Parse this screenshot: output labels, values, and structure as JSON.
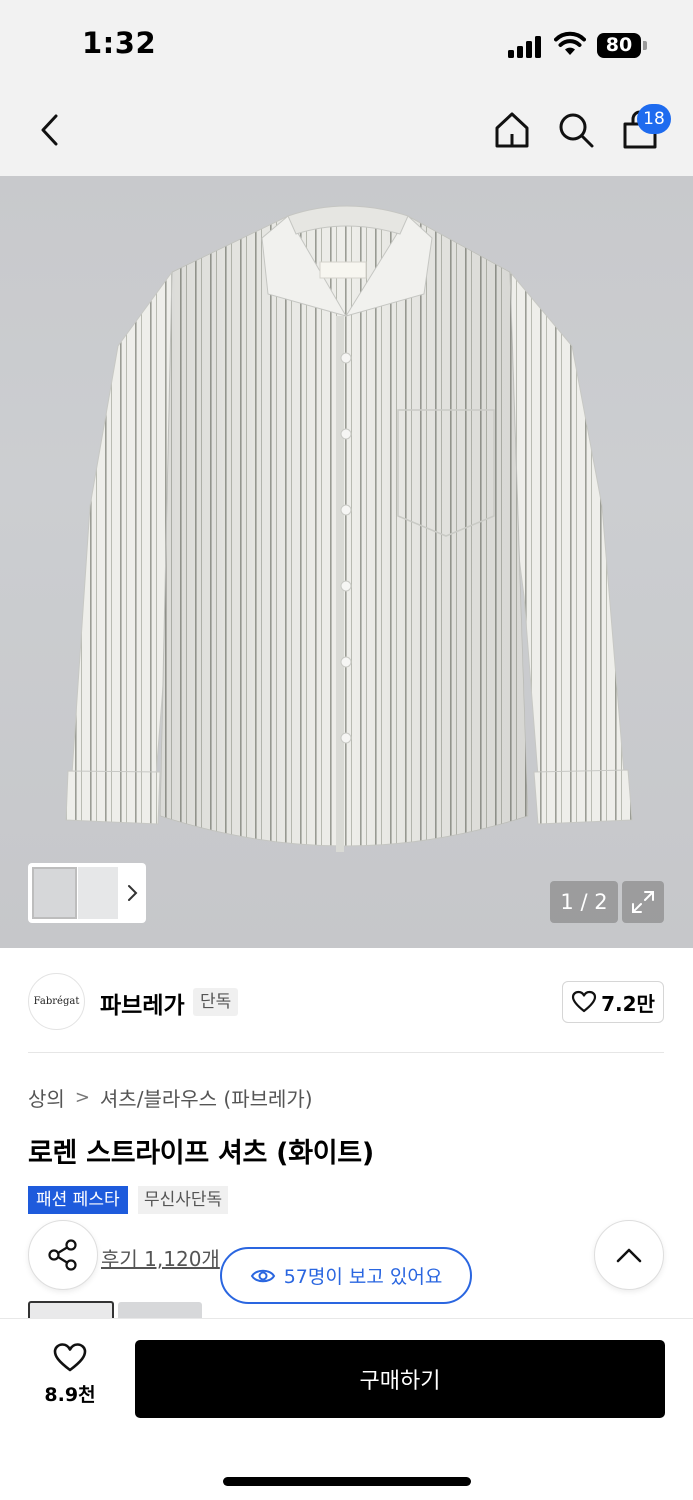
{
  "status_bar": {
    "time": "1:32",
    "battery": "80"
  },
  "nav": {
    "cart_count": "18"
  },
  "image": {
    "counter": "1 / 2"
  },
  "brand": {
    "logo_text": "Fabrégat",
    "name": "파브레가",
    "tag": "단독",
    "likes": "7.2만"
  },
  "breadcrumb": {
    "category": "상의",
    "subcategory": "셔츠/블라우스 (파브레가)"
  },
  "product": {
    "title": "로렌 스트라이프 셔츠 (화이트)",
    "tags": [
      "패션 페스타",
      "무신사단독"
    ],
    "review_link": "후기 1,120개",
    "viewers": "57명이 보고 있어요"
  },
  "bottom": {
    "wish_count": "8.9천",
    "buy_label": "구매하기"
  },
  "colors": {
    "accent": "#1e6bef",
    "tag_blue": "#1e5bdc",
    "viewers_blue": "#2a66e0",
    "buy_bg": "#000000"
  }
}
